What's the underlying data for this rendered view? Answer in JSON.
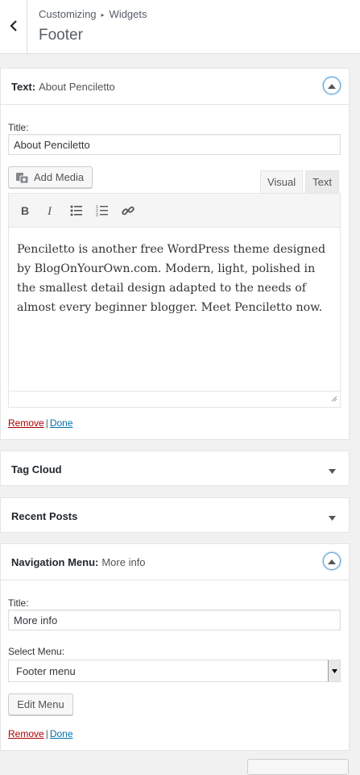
{
  "header": {
    "breadcrumb_root": "Customizing",
    "breadcrumb_section": "Widgets",
    "title": "Footer"
  },
  "text_widget": {
    "title_prefix": "Text:",
    "title_name": "About Penciletto",
    "title_label": "Title:",
    "title_value": "About Penciletto",
    "add_media_label": "Add Media",
    "tab_visual": "Visual",
    "tab_text": "Text",
    "body": "Penciletto is another free WordPress theme designed by BlogOnYourOwn.com. Modern, light, polished in the smallest detail design adapted to the needs of almost every beginner blogger. Meet Penciletto now.",
    "remove_label": "Remove",
    "separator": "|",
    "done_label": "Done"
  },
  "tag_cloud_widget": {
    "title": "Tag Cloud"
  },
  "recent_posts_widget": {
    "title": "Recent Posts"
  },
  "nav_widget": {
    "title_prefix": "Navigation Menu:",
    "title_name": "More info",
    "title_label": "Title:",
    "title_value": "More info",
    "select_label": "Select Menu:",
    "select_value": "Footer menu",
    "edit_menu_label": "Edit Menu",
    "remove_label": "Remove",
    "separator": "|",
    "done_label": "Done"
  },
  "colors": {
    "accent": "#0073aa",
    "remove": "#aa0000",
    "focus_ring": "#5b9dd9"
  }
}
